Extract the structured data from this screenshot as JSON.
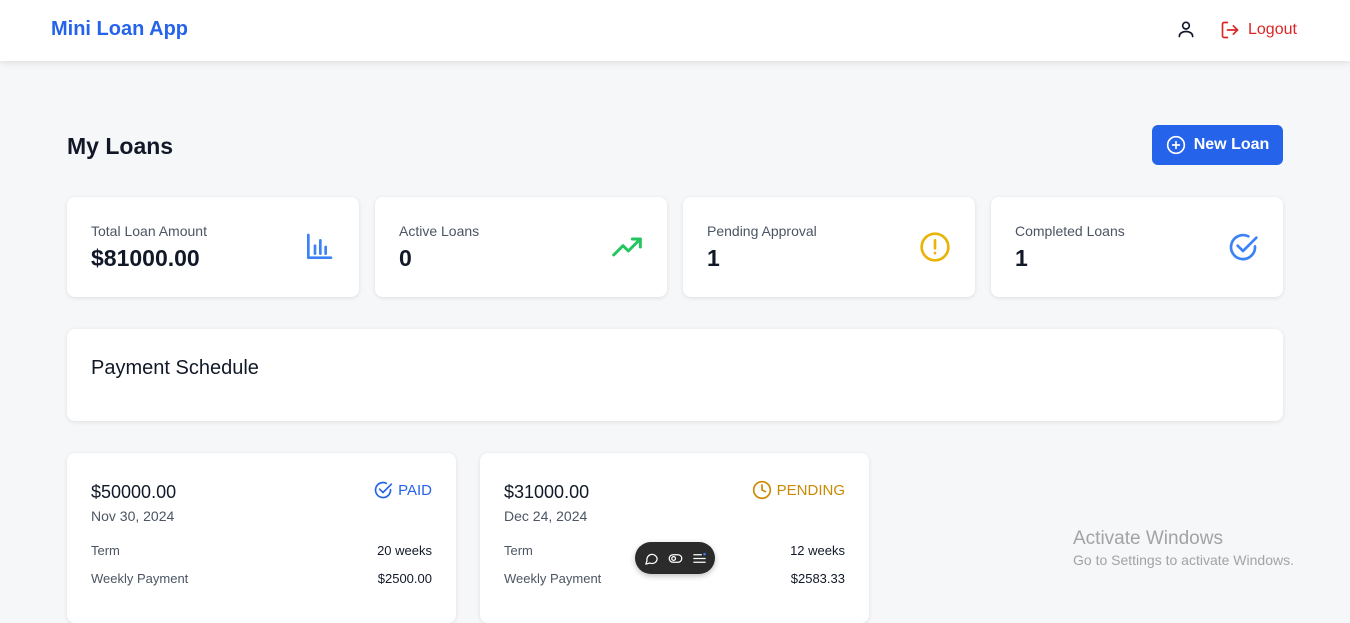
{
  "header": {
    "brand": "Mini Loan App",
    "logout_label": "Logout"
  },
  "page": {
    "title": "My Loans",
    "new_loan_label": "New Loan"
  },
  "stats": [
    {
      "label": "Total Loan Amount",
      "value": "$81000.00",
      "icon": "bar-chart-icon",
      "color": "#3b82f6"
    },
    {
      "label": "Active Loans",
      "value": "0",
      "icon": "trending-up-icon",
      "color": "#22c55e"
    },
    {
      "label": "Pending Approval",
      "value": "1",
      "icon": "alert-circle-icon",
      "color": "#eab308"
    },
    {
      "label": "Completed Loans",
      "value": "1",
      "icon": "check-circle-icon",
      "color": "#3b82f6"
    }
  ],
  "schedule": {
    "title": "Payment Schedule"
  },
  "loans": [
    {
      "amount": "$50000.00",
      "date": "Nov 30, 2024",
      "status": "PAID",
      "status_color": "#2563eb",
      "rows": [
        {
          "key": "Term",
          "value": "20 weeks"
        },
        {
          "key": "Weekly Payment",
          "value": "$2500.00"
        }
      ]
    },
    {
      "amount": "$31000.00",
      "date": "Dec 24, 2024",
      "status": "PENDING",
      "status_color": "#ca8a04",
      "rows": [
        {
          "key": "Term",
          "value": "12 weeks"
        },
        {
          "key": "Weekly Payment",
          "value": "$2583.33"
        }
      ]
    }
  ],
  "watermark": {
    "line1": "Activate Windows",
    "line2": "Go to Settings to activate Windows."
  },
  "colors": {
    "accent": "#2563eb",
    "danger": "#dc2626",
    "background": "#f6f7f9"
  }
}
